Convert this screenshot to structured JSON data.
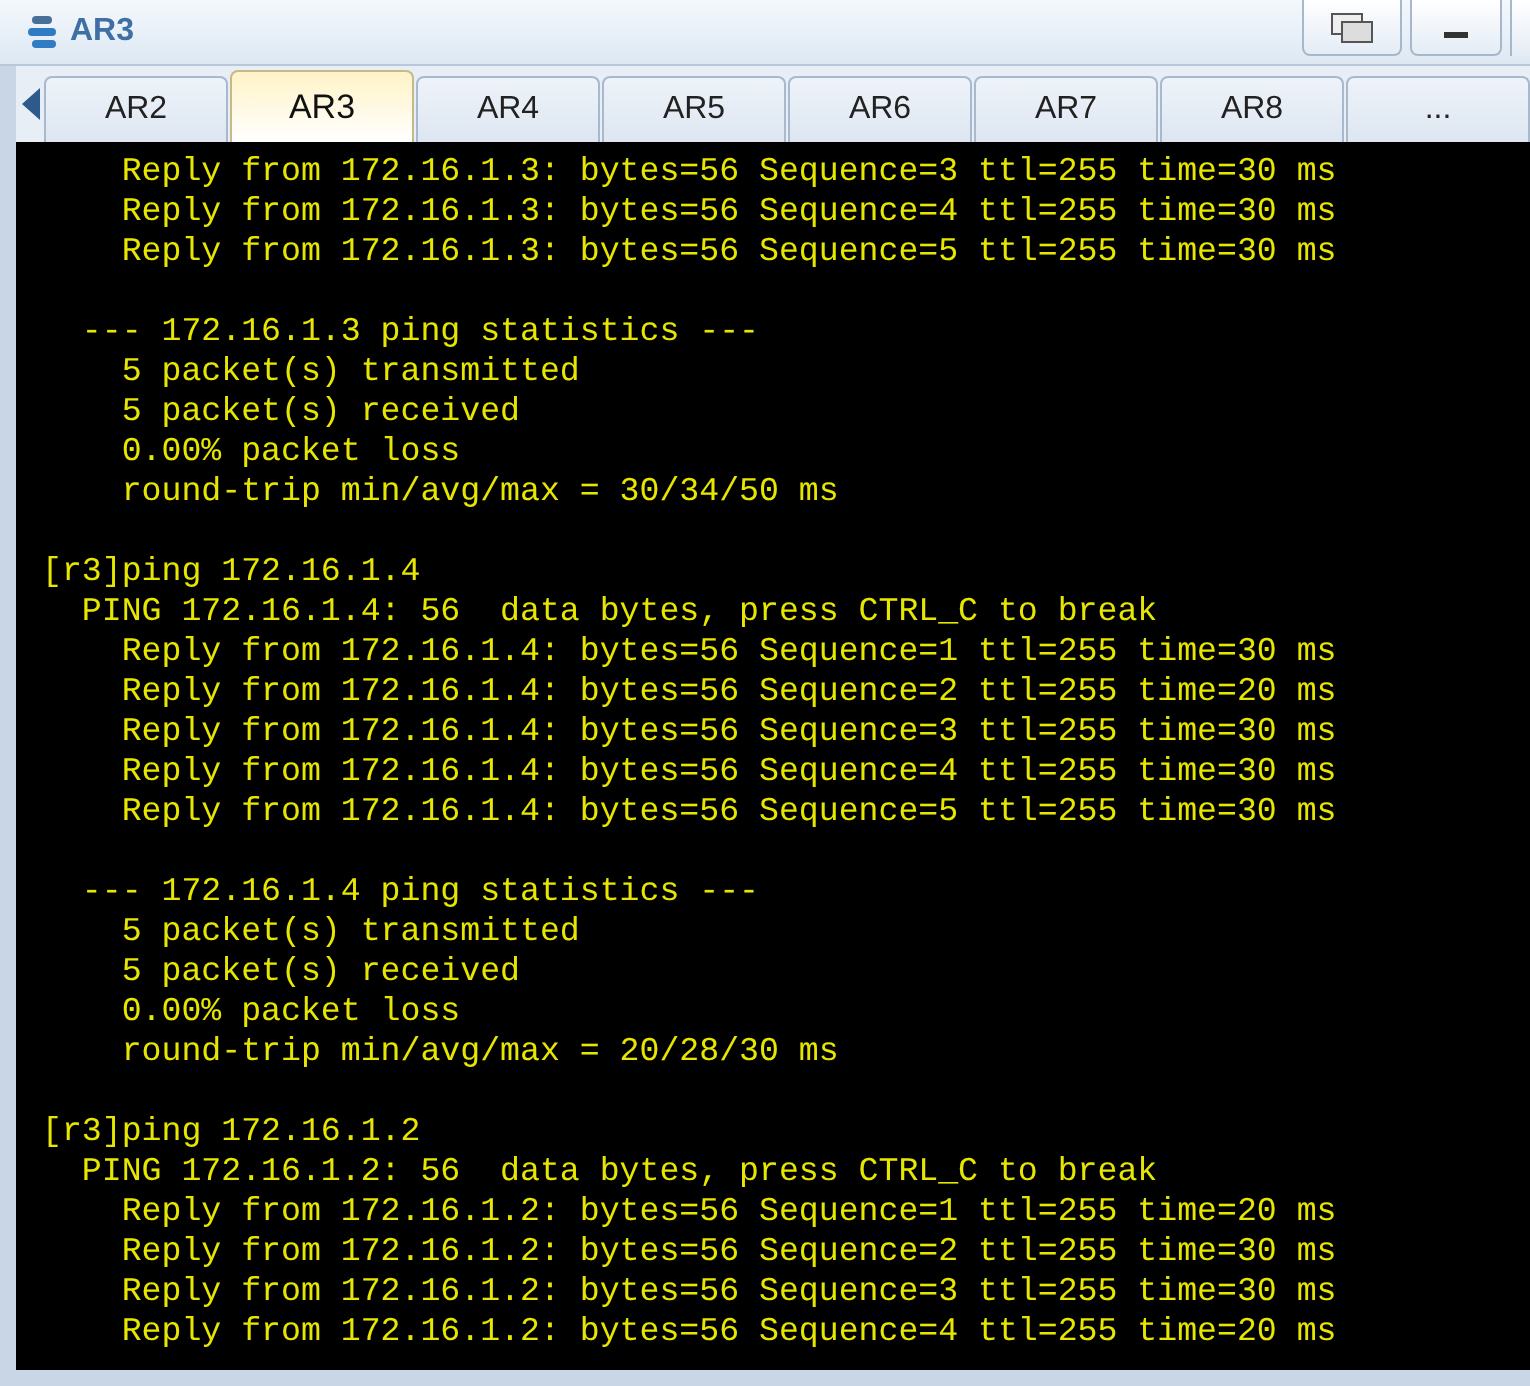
{
  "window": {
    "title": "AR3"
  },
  "tabs": [
    {
      "label": "AR2",
      "selected": false
    },
    {
      "label": "AR3",
      "selected": true
    },
    {
      "label": "AR4",
      "selected": false
    },
    {
      "label": "AR5",
      "selected": false
    },
    {
      "label": "AR6",
      "selected": false
    },
    {
      "label": "AR7",
      "selected": false
    },
    {
      "label": "AR8",
      "selected": false
    },
    {
      "label": "...",
      "selected": false
    }
  ],
  "terminal": {
    "blocks": [
      [
        "    Reply from 172.16.1.3: bytes=56 Sequence=3 ttl=255 time=30 ms",
        "    Reply from 172.16.1.3: bytes=56 Sequence=4 ttl=255 time=30 ms",
        "    Reply from 172.16.1.3: bytes=56 Sequence=5 ttl=255 time=30 ms"
      ],
      [
        "  --- 172.16.1.3 ping statistics ---",
        "    5 packet(s) transmitted",
        "    5 packet(s) received",
        "    0.00% packet loss",
        "    round-trip min/avg/max = 30/34/50 ms"
      ],
      [
        "[r3]ping 172.16.1.4",
        "  PING 172.16.1.4: 56  data bytes, press CTRL_C to break",
        "    Reply from 172.16.1.4: bytes=56 Sequence=1 ttl=255 time=30 ms",
        "    Reply from 172.16.1.4: bytes=56 Sequence=2 ttl=255 time=20 ms",
        "    Reply from 172.16.1.4: bytes=56 Sequence=3 ttl=255 time=30 ms",
        "    Reply from 172.16.1.4: bytes=56 Sequence=4 ttl=255 time=30 ms",
        "    Reply from 172.16.1.4: bytes=56 Sequence=5 ttl=255 time=30 ms"
      ],
      [
        "  --- 172.16.1.4 ping statistics ---",
        "    5 packet(s) transmitted",
        "    5 packet(s) received",
        "    0.00% packet loss",
        "    round-trip min/avg/max = 20/28/30 ms"
      ],
      [
        "[r3]ping 172.16.1.2",
        "  PING 172.16.1.2: 56  data bytes, press CTRL_C to break",
        "    Reply from 172.16.1.2: bytes=56 Sequence=1 ttl=255 time=20 ms",
        "    Reply from 172.16.1.2: bytes=56 Sequence=2 ttl=255 time=30 ms",
        "    Reply from 172.16.1.2: bytes=56 Sequence=3 ttl=255 time=30 ms",
        "    Reply from 172.16.1.2: bytes=56 Sequence=4 ttl=255 time=20 ms"
      ]
    ]
  }
}
